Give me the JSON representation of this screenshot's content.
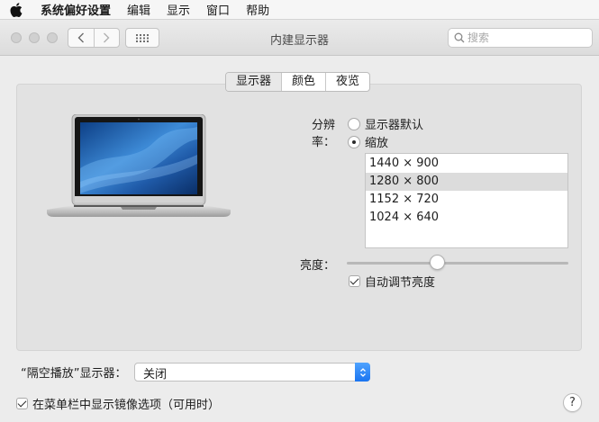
{
  "menubar": {
    "app_name": "系统偏好设置",
    "items": [
      "编辑",
      "显示",
      "窗口",
      "帮助"
    ]
  },
  "window": {
    "title": "内建显示器",
    "search_placeholder": "搜索"
  },
  "tabs": [
    {
      "label": "显示器",
      "selected": true
    },
    {
      "label": "颜色",
      "selected": false
    },
    {
      "label": "夜览",
      "selected": false
    }
  ],
  "resolution": {
    "label": "分辨率：",
    "options": [
      {
        "label": "显示器默认",
        "checked": false
      },
      {
        "label": "缩放",
        "checked": true
      }
    ],
    "list": [
      "1440 × 900",
      "1280 × 800",
      "1152 × 720",
      "1024 × 640"
    ],
    "selected_index": 1
  },
  "brightness": {
    "label": "亮度：",
    "level": 0.4,
    "auto_label": "自动调节亮度",
    "auto_checked": true
  },
  "airplay": {
    "label": "“隔空播放”显示器：",
    "value": "关闭"
  },
  "mirror_option": {
    "label": "在菜单栏中显示镜像选项（可用时）",
    "checked": true
  },
  "help_label": "?",
  "icons": [
    "apple-logo-icon",
    "chevron-left-icon",
    "chevron-right-icon",
    "grid-icon",
    "search-icon",
    "updown-chevron-icon",
    "checkmark-icon"
  ],
  "colors": {
    "accent": "#1a74f0",
    "panel_bg": "#e2e2e2",
    "window_bg": "#ececec"
  }
}
